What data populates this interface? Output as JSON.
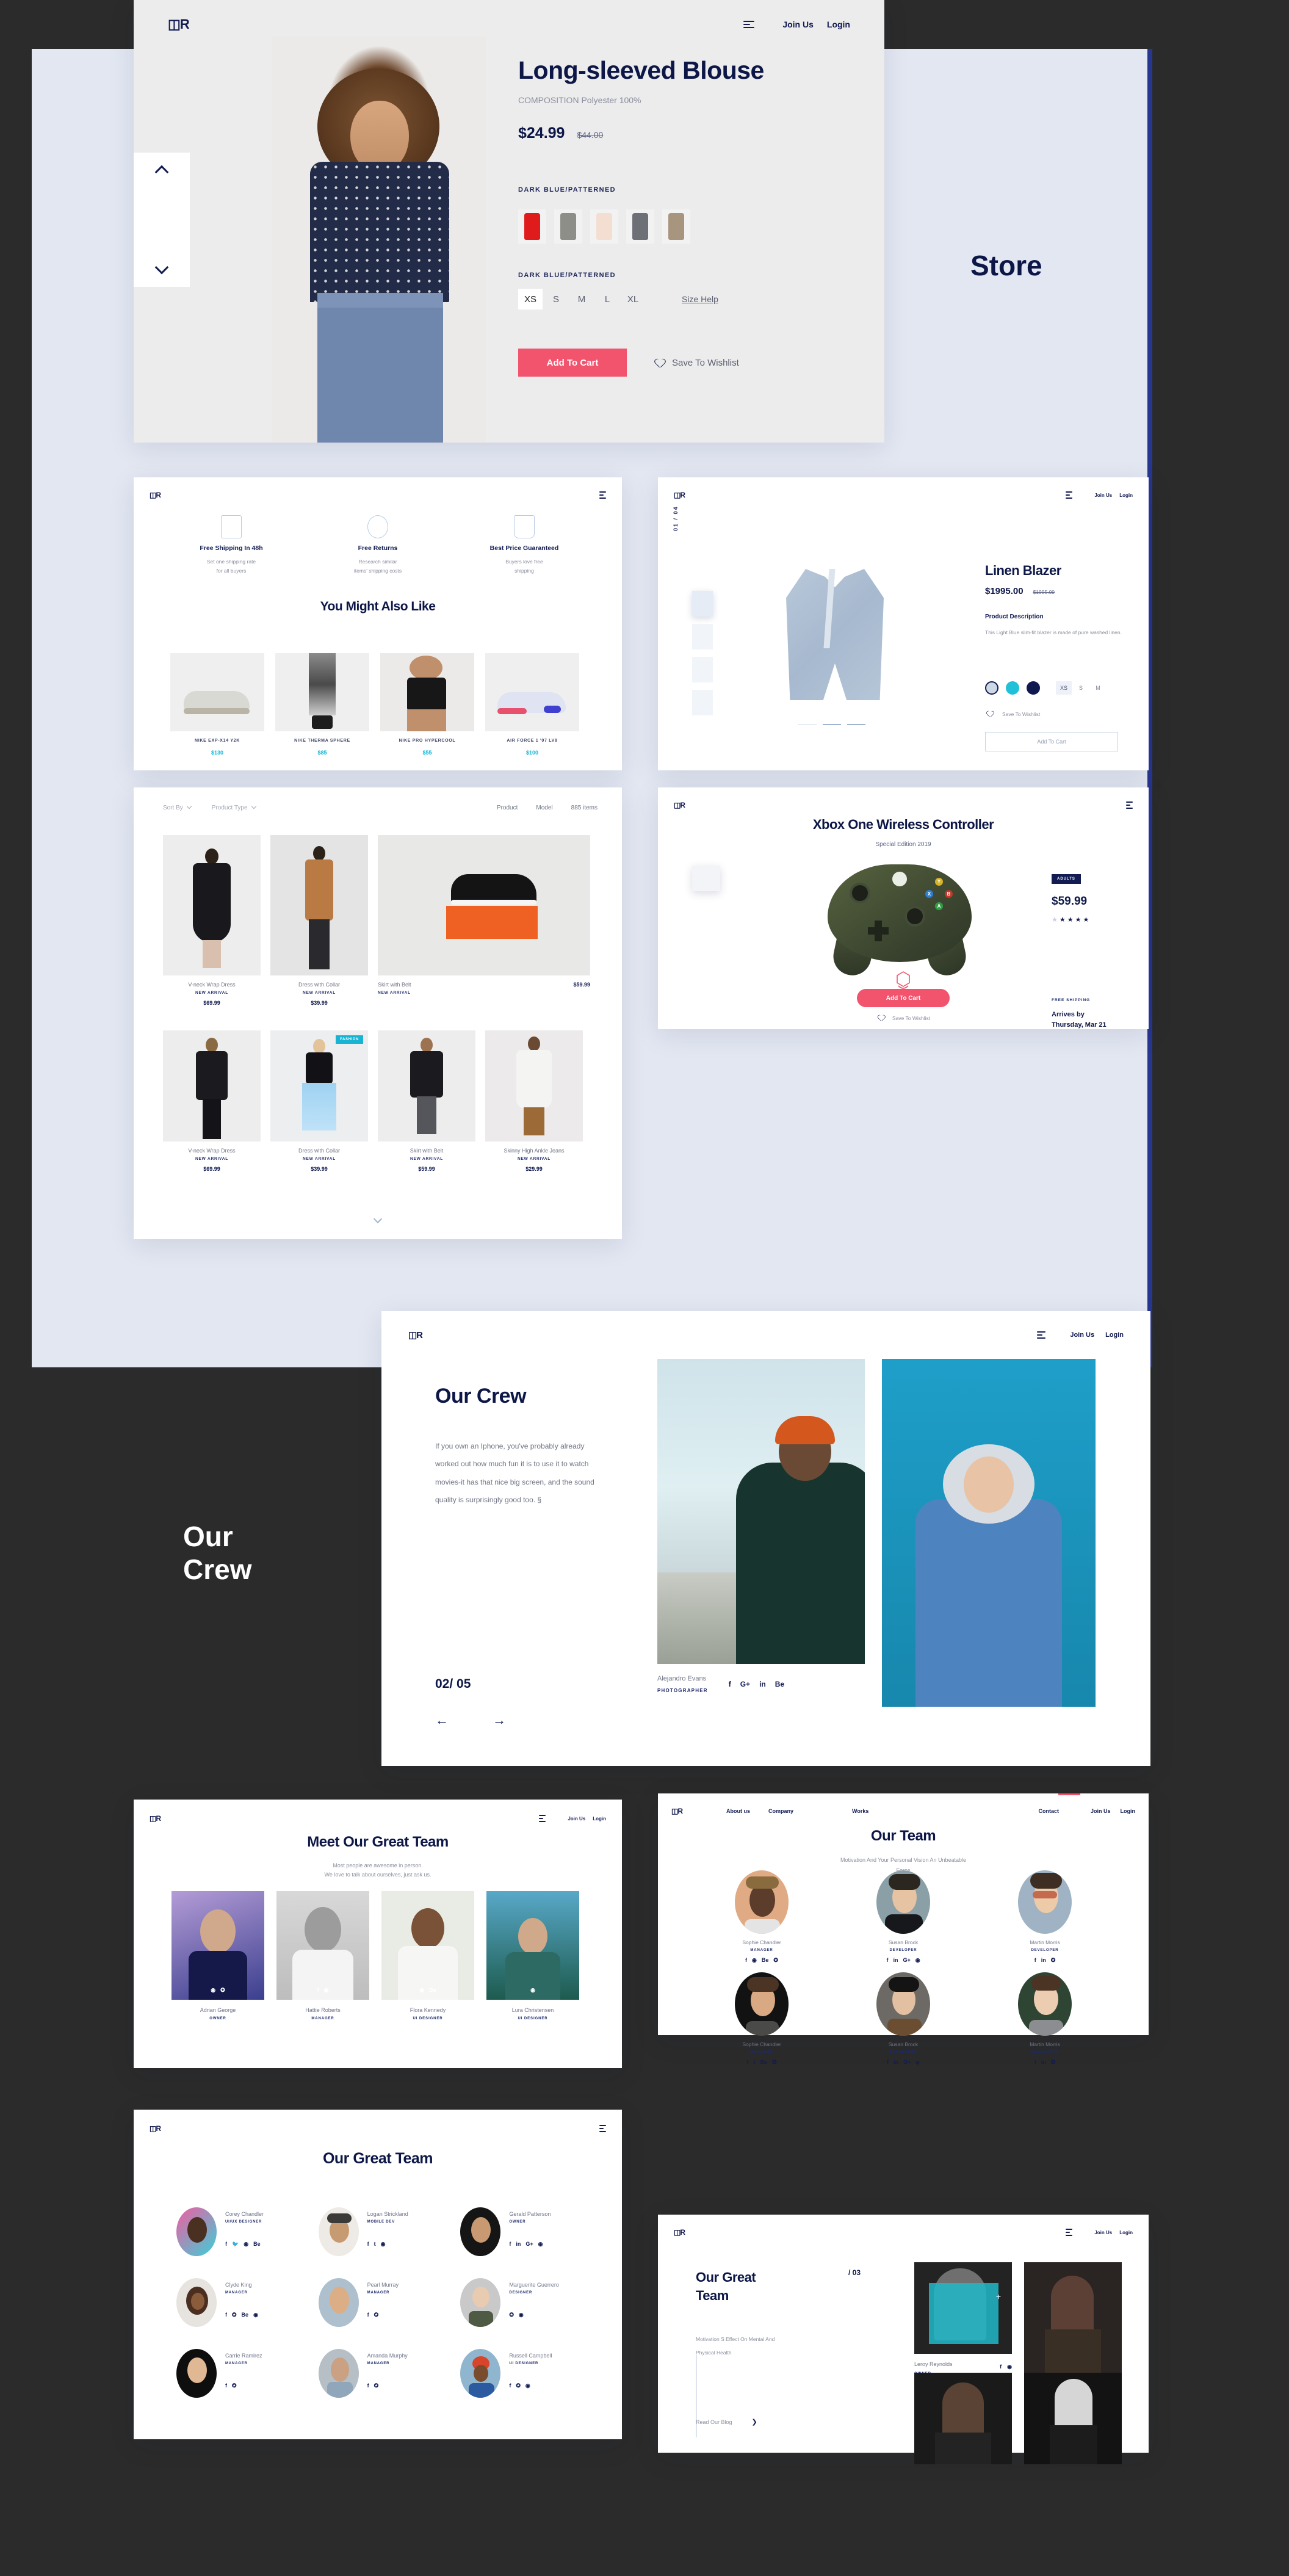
{
  "brand": {
    "logo": "◫R"
  },
  "nav": {
    "join": "Join Us",
    "login": "Login",
    "about": "About us",
    "company": "Company",
    "works": "Works",
    "contact": "Contact"
  },
  "labels": {
    "store_word": "Store",
    "crew_word_line1": "Our",
    "crew_word_line2": "Crew"
  },
  "hero": {
    "title": "Long-sleeved Blouse",
    "composition": "COMPOSITION Polyester 100%",
    "price": "$24.99",
    "old_price": "$44.00",
    "color_label": "DARK BLUE/PATTERNED",
    "size_label": "DARK BLUE/PATTERNED",
    "sizes": [
      "XS",
      "S",
      "M",
      "L",
      "XL"
    ],
    "selected_size": "XS",
    "size_help": "Size Help",
    "add_to_cart": "Add To Cart",
    "wishlist": "Save To Wishlist",
    "swatch_colors": [
      "#e01b1b",
      "#8e8e88",
      "#f4ded2",
      "#6d7076",
      "#a79580"
    ]
  },
  "alsolike": {
    "features": [
      {
        "title": "Free Shipping In 48h",
        "line1": "Set one shipping rate",
        "line2": "for all buyers",
        "icon": "box-icon"
      },
      {
        "title": "Free Returns",
        "line1": "Research similar",
        "line2": "items' shipping costs",
        "icon": "clock-icon"
      },
      {
        "title": "Best Price Guaranteed",
        "line1": "Buyers love free",
        "line2": "shipping",
        "icon": "tag-icon"
      }
    ],
    "heading": "You Might Also Like",
    "products": [
      {
        "name": "NIKE EXP-X14 Y2K",
        "price": "$130"
      },
      {
        "name": "NIKE THERMA SPHERE",
        "price": "$85"
      },
      {
        "name": "NIKE PRO HYPERCOOL",
        "price": "$55"
      },
      {
        "name": "AIR FORCE 1 '07 LV8",
        "price": "$100"
      }
    ]
  },
  "blazer": {
    "counter": "01 / 04",
    "title": "Linen Blazer",
    "price": "$1995.00",
    "old_price": "$1995.00",
    "desc_title": "Product Description",
    "desc": "This Light Blue slim-fit blazer is made of pure washed linen.",
    "colors": [
      "#cfd9e6",
      "#1fc0d8",
      "#10194f"
    ],
    "sizes": [
      "XS",
      "S",
      "M"
    ],
    "selected_size": "XS",
    "wishlist": "Save To Wishlist",
    "add_to_cart": "Add To Cart"
  },
  "grid": {
    "sort_by": "Sort By",
    "product_type": "Product Type",
    "col_product": "Product",
    "col_model": "Model",
    "items_count": "885 items",
    "badge": "FASHION",
    "row1": [
      {
        "name": "V-neck Wrap Dress",
        "tag": "NEW ARRIVAL",
        "price": "$69.99"
      },
      {
        "name": "Dress with Collar",
        "tag": "NEW ARRIVAL",
        "price": "$39.99"
      },
      {
        "name": "Skirt with Belt",
        "tag": "NEW ARRIVAL",
        "price": "$59.99"
      }
    ],
    "row2": [
      {
        "name": "V-neck Wrap Dress",
        "tag": "NEW ARRIVAL",
        "price": "$69.99"
      },
      {
        "name": "Dress with Collar",
        "tag": "NEW ARRIVAL",
        "price": "$39.99"
      },
      {
        "name": "Skirt with Belt",
        "tag": "NEW ARRIVAL",
        "price": "$59.99"
      },
      {
        "name": "Skinny High Ankle Jeans",
        "tag": "NEW ARRIVAL",
        "price": "$29.99"
      }
    ]
  },
  "xbox": {
    "title": "Xbox One Wireless Controller",
    "subtitle": "Special Edition 2019",
    "badge": "ADULTS",
    "price": "$59.99",
    "rating": 4,
    "shipping_label": "FREE SHIPPING",
    "arrives_line1": "Arrives by",
    "arrives_line2": "Thursday, Mar 21",
    "add_to_cart": "Add To Cart",
    "wishlist": "Save To Wishlist"
  },
  "crew": {
    "title": "Our Crew",
    "body": "If you own an Iphone, you've probably already worked out how much fun it is to use it to watch movies-it has that nice big screen, and the sound quality is surprisingly good too. §",
    "counter": "02/ 05",
    "prev": "←",
    "next": "→",
    "person_name": "Alejandro Evans",
    "person_role": "PHOTOGRAPHER",
    "socials": [
      "f",
      "G+",
      "in",
      "Be"
    ]
  },
  "meet": {
    "title": "Meet Our Great Team",
    "sub1": "Most people are awesome in person.",
    "sub2": "We love to talk about ourselves, just ask us.",
    "people": [
      {
        "name": "Adrian George",
        "role": "OWNER",
        "socials": [
          "◉",
          "✪"
        ]
      },
      {
        "name": "Hattie Roberts",
        "role": "MANAGER",
        "socials": [
          "f",
          "◉"
        ]
      },
      {
        "name": "Flora Kennedy",
        "role": "UI DESIGNER",
        "socials": [
          "◉",
          "Be"
        ]
      },
      {
        "name": "Lura Christensen",
        "role": "UI DESIGNER",
        "socials": [
          "◉"
        ]
      }
    ]
  },
  "ourteam": {
    "title": "Our Team",
    "sub1": "Motivation And Your Personal Vision An Unbeatable",
    "sub2": "Force",
    "people": [
      {
        "name": "Sophie Chandler",
        "role": "MANAGER",
        "socials": [
          "f",
          "◉",
          "Be",
          "✪"
        ]
      },
      {
        "name": "Susan Brock",
        "role": "DEVELOPER",
        "socials": [
          "f",
          "in",
          "G+",
          "◉"
        ]
      },
      {
        "name": "Martin Morris",
        "role": "DEVELOPER",
        "socials": [
          "f",
          "in",
          "✪"
        ]
      },
      {
        "name": "Sophie Chandler",
        "role": "MANAGER",
        "socials": [
          "f",
          "t",
          "Be",
          "✪"
        ]
      },
      {
        "name": "Susan Brock",
        "role": "DEVELOPER",
        "socials": [
          "f",
          "in",
          "G+",
          "φ"
        ]
      },
      {
        "name": "Martin Morris",
        "role": "DEVELOPER",
        "socials": [
          "f",
          "in",
          "✪"
        ]
      }
    ]
  },
  "greatteam": {
    "title": "Our Great Team",
    "people": [
      {
        "name": "Corey Chandler",
        "role": "UI/UX DESIGNER",
        "socials": [
          "f",
          "🐦",
          "◉",
          "Be"
        ]
      },
      {
        "name": "Logan Strickland",
        "role": "MOBILE DEV",
        "socials": [
          "f",
          "t",
          "◉"
        ]
      },
      {
        "name": "Gerald Patterson",
        "role": "OWNER",
        "socials": [
          "f",
          "in",
          "G+",
          "◉"
        ]
      },
      {
        "name": "Clyde King",
        "role": "MANAGER",
        "socials": [
          "f",
          "✪",
          "Be",
          "◉"
        ]
      },
      {
        "name": "Pearl Murray",
        "role": "MANAGER",
        "socials": [
          "f",
          "✪"
        ]
      },
      {
        "name": "Marguerite Guerrero",
        "role": "DESIGNER",
        "socials": [
          "✪",
          "◉"
        ]
      },
      {
        "name": "Carrie Ramirez",
        "role": "MANAGER",
        "socials": [
          "f",
          "✪"
        ]
      },
      {
        "name": "Amanda Murphy",
        "role": "MANAGER",
        "socials": [
          "f",
          "✪"
        ]
      },
      {
        "name": "Russell Campbell",
        "role": "UI DESIGNER",
        "socials": [
          "f",
          "✪",
          "◉"
        ]
      }
    ]
  },
  "greatteam2": {
    "title_line1": "Our Great",
    "title_line2": "Team",
    "counter": "/ 03",
    "sub1": "Motivation S Effect On Mental And",
    "sub2": "Physical Health",
    "person_name": "Leroy Reynolds",
    "person_role": "OWNER",
    "socials": [
      "f",
      "◉"
    ],
    "blog_link": "Read Our Blog",
    "blog_arrow": "❯",
    "plus": "+"
  },
  "colors": {
    "navy": "#0d1747",
    "pink": "#f2536d",
    "cyan": "#12b5d8",
    "lavender": "#e2e7f2",
    "dark": "#2b2b2b"
  }
}
